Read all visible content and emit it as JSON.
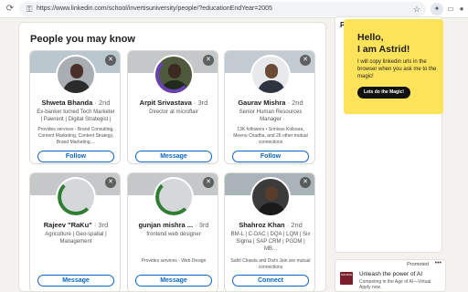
{
  "browser": {
    "url": "https://www.linkedin.com/school/invertisuniversity/people/?educationEndYear=2005",
    "icons": [
      "reload-icon",
      "lock-icon",
      "star-icon",
      "extension-icon",
      "sidebar-icon",
      "profile-icon"
    ]
  },
  "panel": {
    "title": "People you may know"
  },
  "cards": [
    {
      "name": "Shweta Bhanda",
      "degree": "· 2nd",
      "headline": "Ex-banker turned Tech Marketer | Pawrent | Digital Strategist |",
      "extra": "Provides services - Brand Consulting, Content Marketing, Content Strategy, Brand Marketing,...",
      "action": "Follow"
    },
    {
      "name": "Arpit Srivastava",
      "degree": "· 3rd",
      "headline": "Director at microflair",
      "extra": "",
      "action": "Message"
    },
    {
      "name": "Gaurav Mishra",
      "degree": "· 2nd",
      "headline": "Senior Human Resources Manager",
      "extra": "13K followers • Srinivas Kolloara, Meenu Chadha, and 26 other mutual connections",
      "action": "Follow"
    },
    {
      "name": "Rajeev \"RaKu\"",
      "degree": "· 3rd",
      "headline": "Agriculture | Geo-spatial | Management",
      "extra": "",
      "action": "Message"
    },
    {
      "name": "gunjan mishra ...",
      "degree": "· 3rd",
      "headline": "frontend web designer",
      "extra": "Provides services - Web Design",
      "action": "Message"
    },
    {
      "name": "Shahroz Khan",
      "degree": "· 2nd",
      "headline": "BM-L | C-DAC | DQA | LQM | Six Sigma | SAP CRM | PGDM | MB...",
      "extra": "Sahil Chawla and Dishi Jain are mutual connections",
      "action": "Connect"
    }
  ],
  "right": {
    "label": "Pe",
    "promo": {
      "heading_1": "Hello,",
      "heading_2": "I am Astrid!",
      "text": "I will copy linkedin urls in the browser when you ask me to the magic!",
      "button": "Lets do the Magic!"
    },
    "ad": {
      "promoted": "Promoted",
      "dots": "•••",
      "logo_text": "MANIPAL",
      "title": "Unleash the power of AI",
      "subtitle": "Competing in the Age of AI—Virtual. Apply now."
    }
  },
  "colors": {
    "brand": "#0a66c2",
    "promo_bg": "#fde35a",
    "page_bg": "#f4f2ee"
  }
}
